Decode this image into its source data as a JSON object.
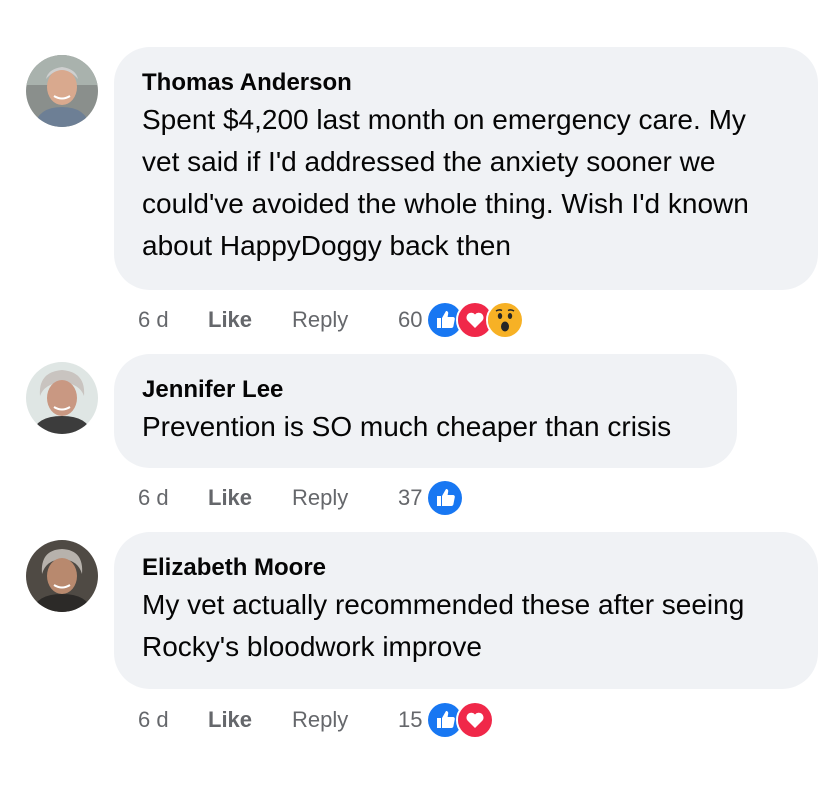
{
  "comments": [
    {
      "author": "Thomas Anderson",
      "text": "Spent $4,200 last month on emergency care. My vet said if I'd addressed the anxiety sooner we could've avoided the whole thing. Wish I'd known about HappyDoggy back then",
      "time": "6 d",
      "like_label": "Like",
      "reply_label": "Reply",
      "reaction_count": "60",
      "reactions": [
        "like-icon",
        "love-icon",
        "wow-icon"
      ]
    },
    {
      "author": "Jennifer Lee",
      "text": "Prevention is SO much cheaper than crisis",
      "time": "6 d",
      "like_label": "Like",
      "reply_label": "Reply",
      "reaction_count": "37",
      "reactions": [
        "like-icon"
      ]
    },
    {
      "author": "Elizabeth Moore",
      "text": "My vet actually recommended these after seeing Rocky's bloodwork improve",
      "time": "6 d",
      "like_label": "Like",
      "reply_label": "Reply",
      "reaction_count": "15",
      "reactions": [
        "like-icon",
        "love-icon"
      ]
    }
  ],
  "colors": {
    "bubble": "#f0f2f5",
    "meta_text": "#65676b",
    "like_blue": "#1877f2",
    "love_red": "#f02849",
    "wow_yellow": "#f7b125"
  }
}
